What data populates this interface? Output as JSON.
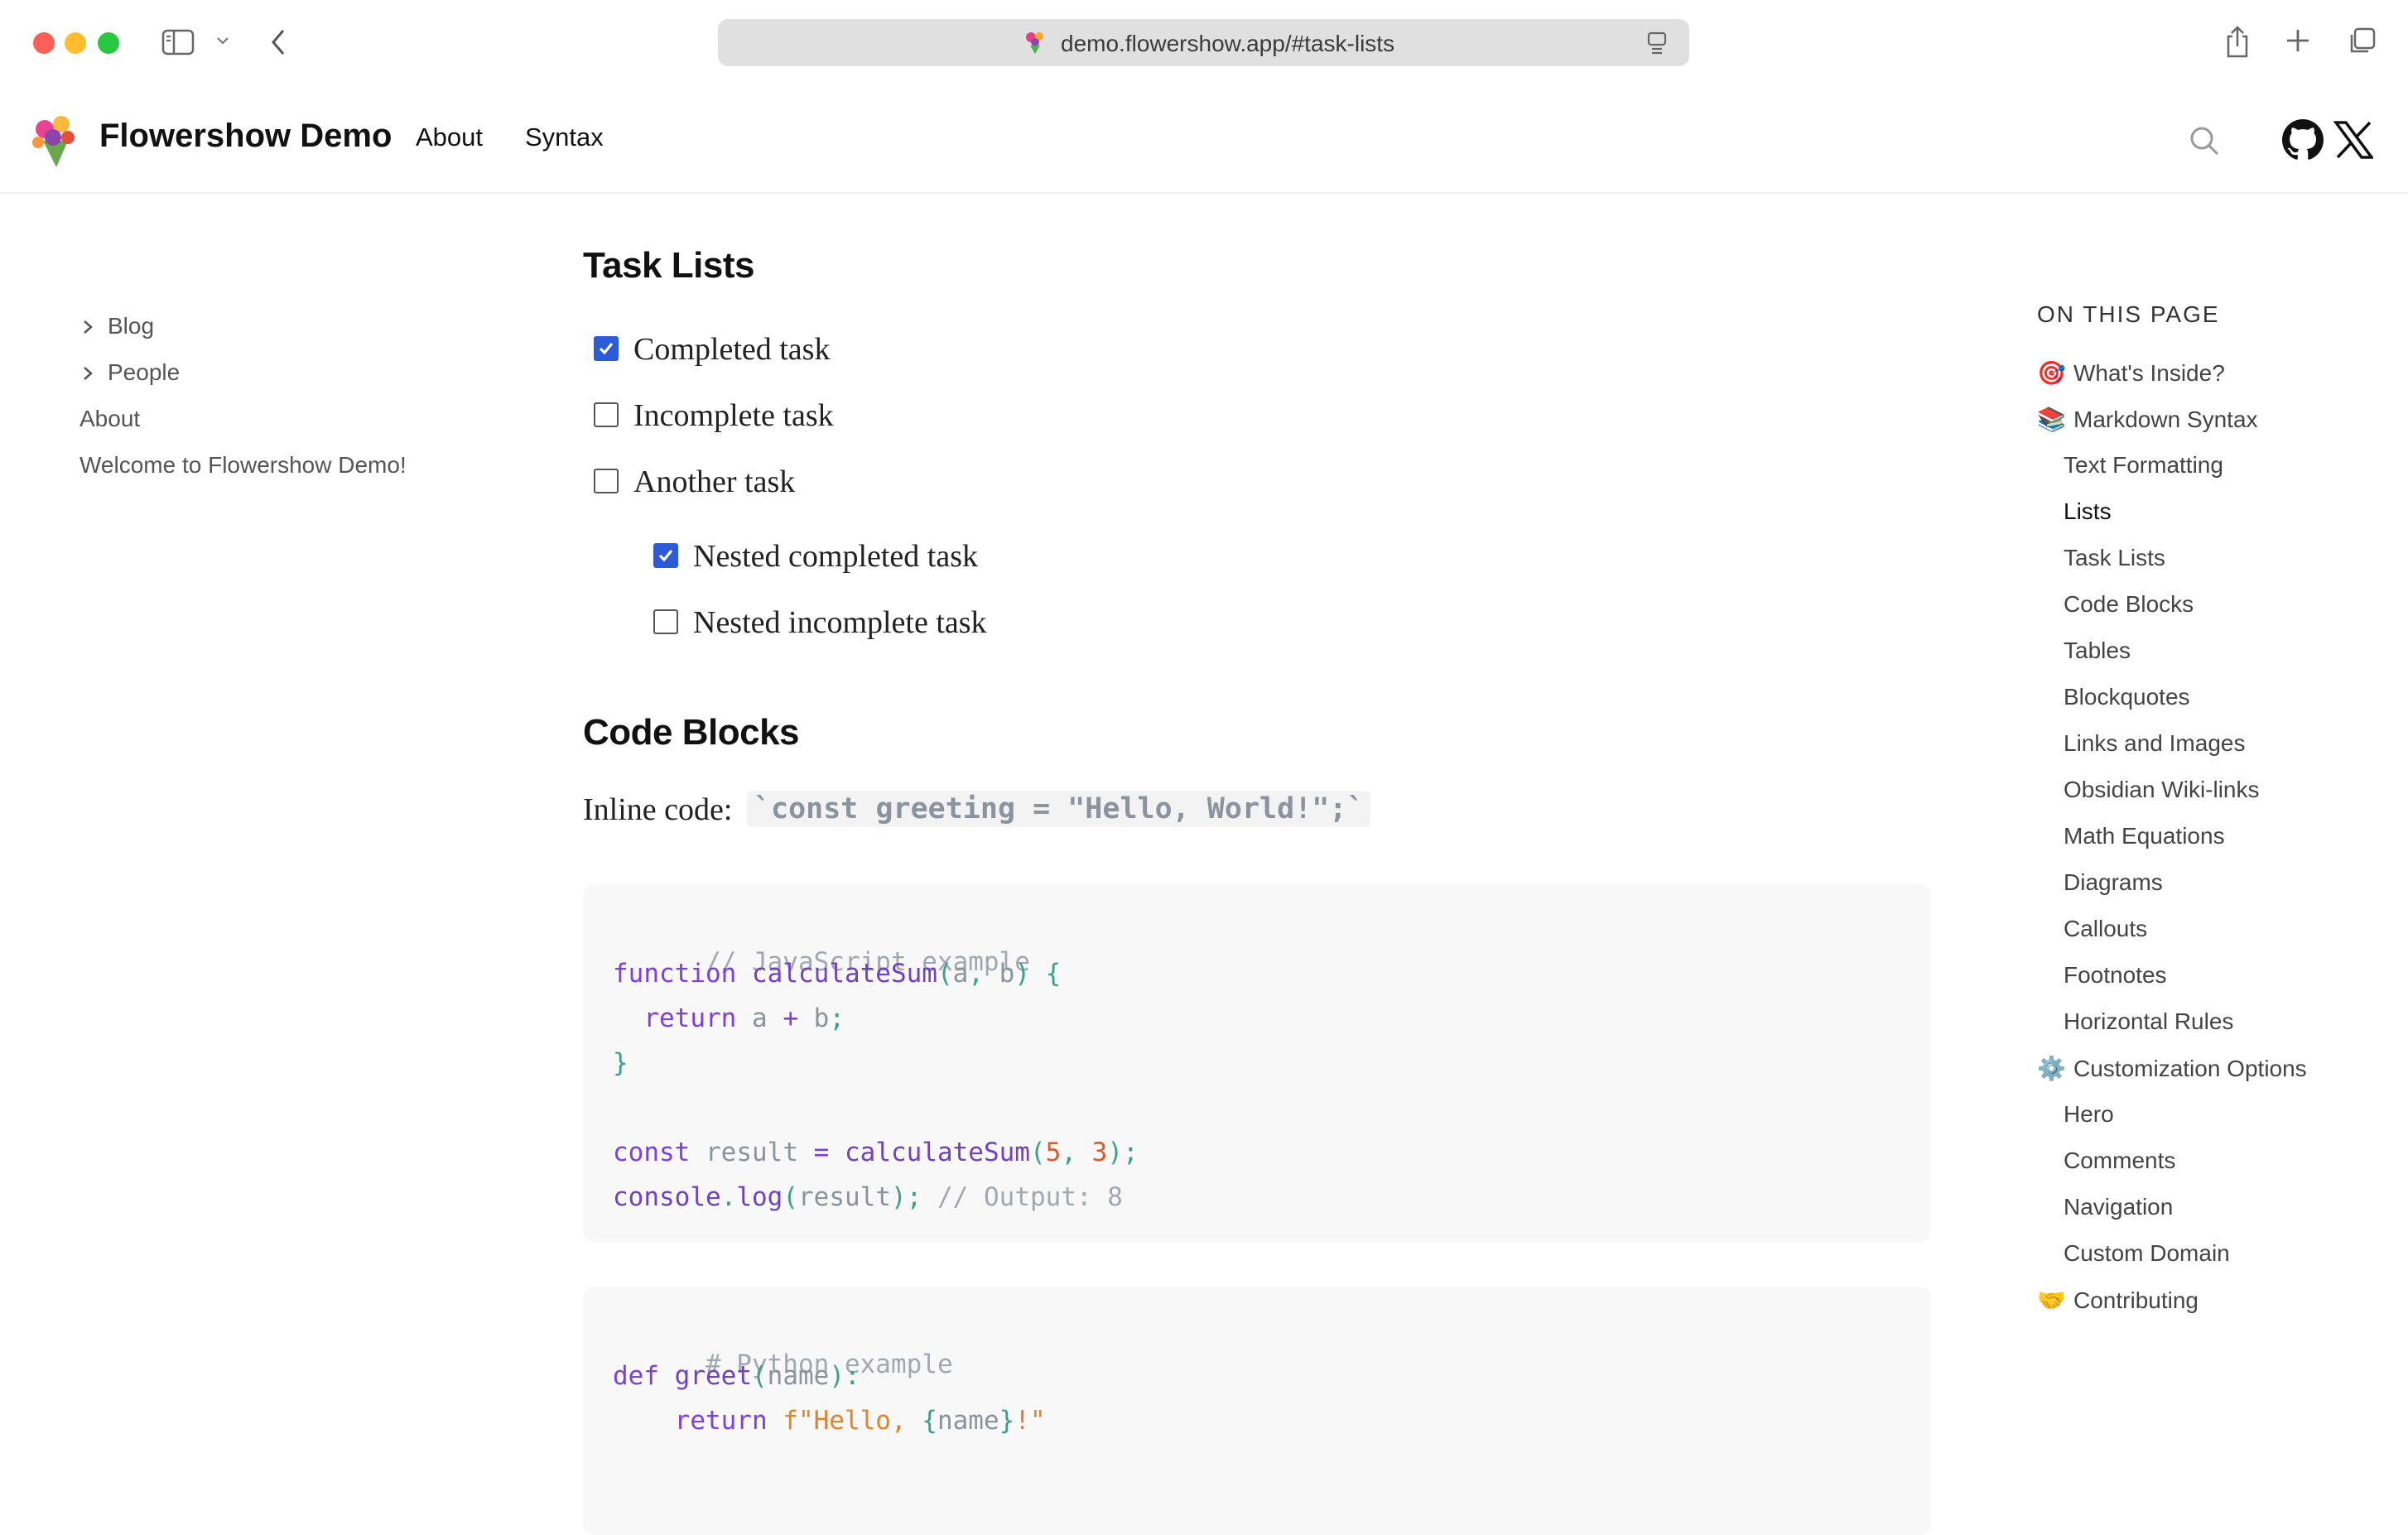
{
  "browser": {
    "url": "demo.flowershow.app/#task-lists",
    "traffic_colors": {
      "close": "#ff5f57",
      "minimize": "#febc2e",
      "zoom": "#28c840"
    }
  },
  "site": {
    "title": "Flowershow Demo",
    "logo_icon": "flower-bouquet-icon",
    "nav": [
      "About",
      "Syntax"
    ]
  },
  "sidebar": {
    "items": [
      {
        "label": "Blog",
        "expandable": true
      },
      {
        "label": "People",
        "expandable": true
      },
      {
        "label": "About",
        "expandable": false
      },
      {
        "label": "Welcome to Flowershow Demo!",
        "expandable": false
      }
    ]
  },
  "content": {
    "task_lists_heading": "Task Lists",
    "tasks": [
      {
        "label": "Completed task",
        "checked": true,
        "nested": false
      },
      {
        "label": "Incomplete task",
        "checked": false,
        "nested": false
      },
      {
        "label": "Another task",
        "checked": false,
        "nested": false
      },
      {
        "label": "Nested completed task",
        "checked": true,
        "nested": true
      },
      {
        "label": "Nested incomplete task",
        "checked": false,
        "nested": true
      }
    ],
    "code_blocks_heading": "Code Blocks",
    "inline_label": "Inline code:",
    "inline_code": "`const greeting = \"Hello, World!\";`",
    "js_code": [
      "// JavaScript example",
      "function calculateSum(a, b) {",
      "  return a + b;",
      "}",
      "",
      "const result = calculateSum(5, 3);",
      "console.log(result); // Output: 8"
    ],
    "py_code": [
      "# Python example",
      "def greet(name):",
      "    return f\"Hello, {name}!\""
    ]
  },
  "toc": {
    "heading": "ON THIS PAGE",
    "items": [
      {
        "label": "What's Inside?",
        "emoji": "🎯",
        "level": 1
      },
      {
        "label": "Markdown Syntax",
        "emoji": "📚",
        "level": 1
      },
      {
        "label": "Text Formatting",
        "level": 2
      },
      {
        "label": "Lists",
        "level": 2,
        "active": true
      },
      {
        "label": "Task Lists",
        "level": 2
      },
      {
        "label": "Code Blocks",
        "level": 2
      },
      {
        "label": "Tables",
        "level": 2
      },
      {
        "label": "Blockquotes",
        "level": 2
      },
      {
        "label": "Links and Images",
        "level": 2
      },
      {
        "label": "Obsidian Wiki-links",
        "level": 2
      },
      {
        "label": "Math Equations",
        "level": 2
      },
      {
        "label": "Diagrams",
        "level": 2
      },
      {
        "label": "Callouts",
        "level": 2
      },
      {
        "label": "Footnotes",
        "level": 2
      },
      {
        "label": "Horizontal Rules",
        "level": 2
      },
      {
        "label": "Customization Options",
        "emoji": "⚙️",
        "level": 1
      },
      {
        "label": "Hero",
        "level": 2
      },
      {
        "label": "Comments",
        "level": 2
      },
      {
        "label": "Navigation",
        "level": 2
      },
      {
        "label": "Custom Domain",
        "level": 2
      },
      {
        "label": "Contributing",
        "emoji": "🤝",
        "level": 1
      }
    ]
  }
}
